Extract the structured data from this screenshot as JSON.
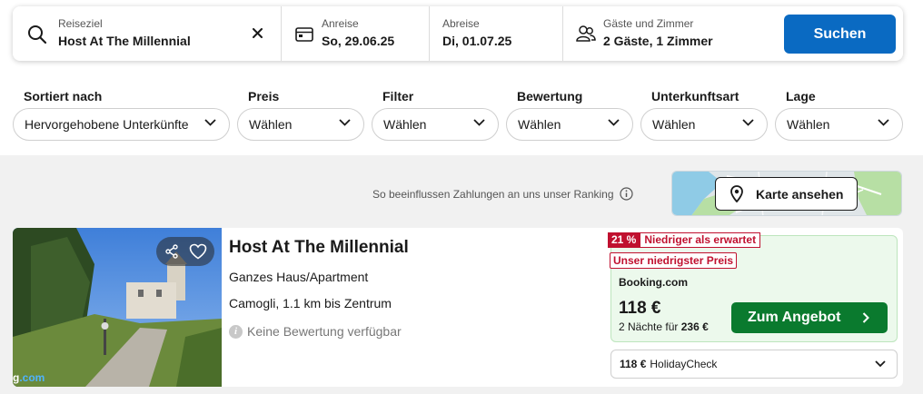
{
  "search": {
    "destination_label": "Reiseziel",
    "destination_value": "Host At The Millennial",
    "checkin_label": "Anreise",
    "checkin_value": "So, 29.06.25",
    "checkout_label": "Abreise",
    "checkout_value": "Di, 01.07.25",
    "guests_label": "Gäste und Zimmer",
    "guests_value": "2 Gäste, 1 Zimmer",
    "submit_label": "Suchen",
    "accent_color": "#0a6ac2"
  },
  "filters": [
    {
      "label": "Sortiert nach",
      "value": "Hervorgehobene Unterkünfte"
    },
    {
      "label": "Preis",
      "value": "Wählen"
    },
    {
      "label": "Filter",
      "value": "Wählen"
    },
    {
      "label": "Bewertung",
      "value": "Wählen"
    },
    {
      "label": "Unterkunftsart",
      "value": "Wählen"
    },
    {
      "label": "Lage",
      "value": "Wählen"
    }
  ],
  "results": {
    "ranking_note": "So beeinflussen Zahlungen an uns unser Ranking",
    "map_button_label": "Karte ansehen"
  },
  "listing": {
    "title": "Host At The Millennial",
    "property_type": "Ganzes Haus/Apartment",
    "location": "Camogli, 1.1 km bis Zentrum",
    "rating_text": "Keine Bewertung verfügbar",
    "rating_icon_letter": "i",
    "watermark_prefix": "g",
    "watermark_suffix": ".com",
    "deal": {
      "discount_percent": "21 %",
      "discount_label": "Niedriger als erwartet",
      "lowest_price_label": "Unser niedrigster Preis",
      "provider": "Booking.com",
      "price": "118 €",
      "nights_text": "2 Nächte für",
      "total_price": "236 €",
      "offer_button_label": "Zum Angebot",
      "badge_color": "#c0102f",
      "offer_color": "#0a7a2e"
    },
    "alternative": {
      "price": "118 €",
      "provider": "HolidayCheck"
    }
  }
}
